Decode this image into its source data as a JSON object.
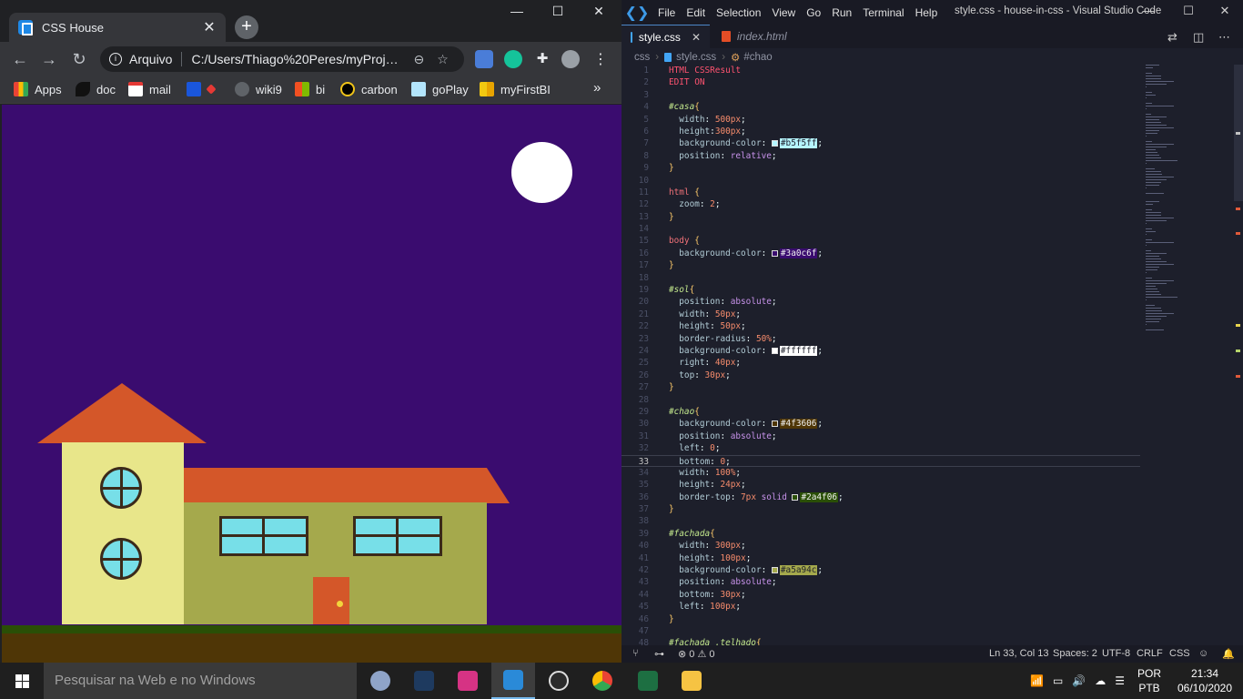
{
  "chrome": {
    "tab_title": "CSS House",
    "close": "✕",
    "new_tab": "+",
    "win_min": "—",
    "win_max": "☐",
    "win_close": "✕",
    "omnibox_prefix": "Arquivo",
    "url": "C:/Users/Thiago%20Peres/myProje...",
    "bookmarks": [
      "Apps",
      "doc",
      "mail",
      "",
      "wiki9",
      "bi",
      "carbon",
      "goPlay",
      "myFirstBI"
    ],
    "more": "»"
  },
  "page": {
    "colors": {
      "body": "#3a0c6f",
      "sol": "#ffffff",
      "chao": "#4f3606",
      "grass": "#2a4f06",
      "fachada": "#a5a94c",
      "tower": "#e8e68a",
      "roof": "#d45729",
      "window": "#77dfe8"
    }
  },
  "vscode": {
    "menu": [
      "File",
      "Edit",
      "Selection",
      "View",
      "Go",
      "Run",
      "Terminal",
      "Help"
    ],
    "title": "style.css - house-in-css - Visual Studio Code",
    "tabs": [
      {
        "label": "style.css",
        "active": true
      },
      {
        "label": "index.html",
        "active": false
      }
    ],
    "breadcrumb": [
      "css",
      "style.css",
      "#chao"
    ],
    "lines": [
      [
        [
          "HTML CSSResult",
          "c-kw"
        ]
      ],
      [
        [
          "EDIT ON",
          "c-kw"
        ]
      ],
      [],
      [
        [
          "#casa",
          "c-sel"
        ],
        [
          "{",
          "c-punct"
        ]
      ],
      [
        [
          "  width",
          "c-prop"
        ],
        [
          ": ",
          "c-plain"
        ],
        [
          "500px",
          "c-num"
        ],
        [
          ";",
          "c-plain"
        ]
      ],
      [
        [
          "  height",
          "c-prop"
        ],
        [
          ":",
          "c-plain"
        ],
        [
          "300px",
          "c-num"
        ],
        [
          ";",
          "c-plain"
        ]
      ],
      [
        [
          "  background-color",
          "c-prop"
        ],
        [
          ": ",
          "c-plain"
        ],
        [
          "#b5f5ff",
          "hex",
          "#b5f5ff"
        ],
        [
          ";",
          "c-plain"
        ]
      ],
      [
        [
          "  position",
          "c-prop"
        ],
        [
          ": ",
          "c-plain"
        ],
        [
          "relative",
          "c-val"
        ],
        [
          ";",
          "c-plain"
        ]
      ],
      [
        [
          "}",
          "c-punct"
        ]
      ],
      [],
      [
        [
          "html",
          "c-tag"
        ],
        [
          " {",
          "c-punct"
        ]
      ],
      [
        [
          "  zoom",
          "c-prop"
        ],
        [
          ": ",
          "c-plain"
        ],
        [
          "2",
          "c-num"
        ],
        [
          ";",
          "c-plain"
        ]
      ],
      [
        [
          "}",
          "c-punct"
        ]
      ],
      [],
      [
        [
          "body",
          "c-tag"
        ],
        [
          " {",
          "c-punct"
        ]
      ],
      [
        [
          "  background-color",
          "c-prop"
        ],
        [
          ": ",
          "c-plain"
        ],
        [
          "#3a0c6f",
          "hex",
          "#3a0c6f"
        ],
        [
          ";",
          "c-plain"
        ]
      ],
      [
        [
          "}",
          "c-punct"
        ]
      ],
      [],
      [
        [
          "#sol",
          "c-sel"
        ],
        [
          "{",
          "c-punct"
        ]
      ],
      [
        [
          "  position",
          "c-prop"
        ],
        [
          ": ",
          "c-plain"
        ],
        [
          "absolute",
          "c-val"
        ],
        [
          ";",
          "c-plain"
        ]
      ],
      [
        [
          "  width",
          "c-prop"
        ],
        [
          ": ",
          "c-plain"
        ],
        [
          "50px",
          "c-num"
        ],
        [
          ";",
          "c-plain"
        ]
      ],
      [
        [
          "  height",
          "c-prop"
        ],
        [
          ": ",
          "c-plain"
        ],
        [
          "50px",
          "c-num"
        ],
        [
          ";",
          "c-plain"
        ]
      ],
      [
        [
          "  border-radius",
          "c-prop"
        ],
        [
          ": ",
          "c-plain"
        ],
        [
          "50%",
          "c-num"
        ],
        [
          ";",
          "c-plain"
        ]
      ],
      [
        [
          "  background-color",
          "c-prop"
        ],
        [
          ": ",
          "c-plain"
        ],
        [
          "#ffffff",
          "hex",
          "#ffffff"
        ],
        [
          ";",
          "c-plain"
        ]
      ],
      [
        [
          "  right",
          "c-prop"
        ],
        [
          ": ",
          "c-plain"
        ],
        [
          "40px",
          "c-num"
        ],
        [
          ";",
          "c-plain"
        ]
      ],
      [
        [
          "  top",
          "c-prop"
        ],
        [
          ": ",
          "c-plain"
        ],
        [
          "30px",
          "c-num"
        ],
        [
          ";",
          "c-plain"
        ]
      ],
      [
        [
          "}",
          "c-punct"
        ]
      ],
      [],
      [
        [
          "#chao",
          "c-sel"
        ],
        [
          "{",
          "c-punct"
        ]
      ],
      [
        [
          "  background-color",
          "c-prop"
        ],
        [
          ": ",
          "c-plain"
        ],
        [
          "#4f3606",
          "hex",
          "#4f3606"
        ],
        [
          ";",
          "c-plain"
        ]
      ],
      [
        [
          "  position",
          "c-prop"
        ],
        [
          ": ",
          "c-plain"
        ],
        [
          "absolute",
          "c-val"
        ],
        [
          ";",
          "c-plain"
        ]
      ],
      [
        [
          "  left",
          "c-prop"
        ],
        [
          ": ",
          "c-plain"
        ],
        [
          "0",
          "c-num"
        ],
        [
          ";",
          "c-plain"
        ]
      ],
      [
        [
          "  bottom",
          "c-prop"
        ],
        [
          ": ",
          "c-plain"
        ],
        [
          "0",
          "c-num"
        ],
        [
          ";",
          "c-plain"
        ]
      ],
      [
        [
          "  width",
          "c-prop"
        ],
        [
          ": ",
          "c-plain"
        ],
        [
          "100%",
          "c-num"
        ],
        [
          ";",
          "c-plain"
        ]
      ],
      [
        [
          "  height",
          "c-prop"
        ],
        [
          ": ",
          "c-plain"
        ],
        [
          "24px",
          "c-num"
        ],
        [
          ";",
          "c-plain"
        ]
      ],
      [
        [
          "  border-top",
          "c-prop"
        ],
        [
          ": ",
          "c-plain"
        ],
        [
          "7px",
          "c-num"
        ],
        [
          " solid ",
          "c-val"
        ],
        [
          "#2a4f06",
          "hex",
          "#2a4f06"
        ],
        [
          ";",
          "c-plain"
        ]
      ],
      [
        [
          "}",
          "c-punct"
        ]
      ],
      [],
      [
        [
          "#fachada",
          "c-sel"
        ],
        [
          "{",
          "c-punct"
        ]
      ],
      [
        [
          "  width",
          "c-prop"
        ],
        [
          ": ",
          "c-plain"
        ],
        [
          "300px",
          "c-num"
        ],
        [
          ";",
          "c-plain"
        ]
      ],
      [
        [
          "  height",
          "c-prop"
        ],
        [
          ": ",
          "c-plain"
        ],
        [
          "100px",
          "c-num"
        ],
        [
          ";",
          "c-plain"
        ]
      ],
      [
        [
          "  background-color",
          "c-prop"
        ],
        [
          ": ",
          "c-plain"
        ],
        [
          "#a5a94c",
          "hex",
          "#a5a94c"
        ],
        [
          ";",
          "c-plain"
        ]
      ],
      [
        [
          "  position",
          "c-prop"
        ],
        [
          ": ",
          "c-plain"
        ],
        [
          "absolute",
          "c-val"
        ],
        [
          ";",
          "c-plain"
        ]
      ],
      [
        [
          "  bottom",
          "c-prop"
        ],
        [
          ": ",
          "c-plain"
        ],
        [
          "30px",
          "c-num"
        ],
        [
          ";",
          "c-plain"
        ]
      ],
      [
        [
          "  left",
          "c-prop"
        ],
        [
          ": ",
          "c-plain"
        ],
        [
          "100px",
          "c-num"
        ],
        [
          ";",
          "c-plain"
        ]
      ],
      [
        [
          "}",
          "c-punct"
        ]
      ],
      [],
      [
        [
          "#fachada .telhado",
          "c-sel"
        ],
        [
          "{",
          "c-punct"
        ]
      ]
    ],
    "current_line": 33,
    "status": {
      "errors": "0",
      "warnings": "0",
      "position": "Ln 33, Col 13",
      "spaces": "Spaces: 2",
      "encoding": "UTF-8",
      "eol": "CRLF",
      "language": "CSS"
    }
  },
  "taskbar": {
    "search_placeholder": "Pesquisar na Web e no Windows",
    "lang_1": "POR",
    "lang_2": "PTB",
    "time": "21:34",
    "date": "06/10/2020"
  }
}
